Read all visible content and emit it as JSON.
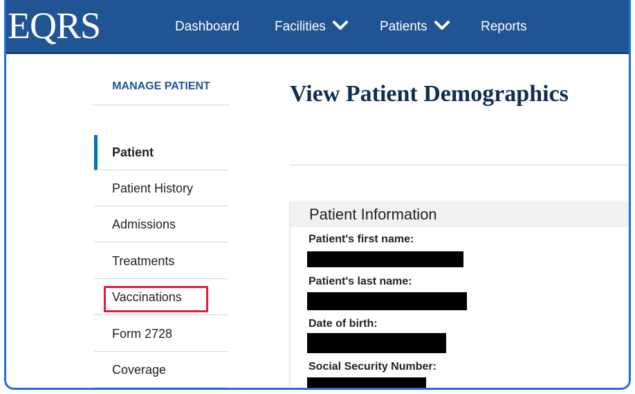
{
  "header": {
    "logo": "EQRS",
    "nav": [
      {
        "label": "Dashboard"
      },
      {
        "label": "Facilities"
      },
      {
        "label": "Patients"
      },
      {
        "label": "Reports"
      }
    ]
  },
  "sidebar": {
    "title": "MANAGE PATIENT",
    "items": [
      {
        "label": "Patient",
        "active": true
      },
      {
        "label": "Patient History"
      },
      {
        "label": "Admissions"
      },
      {
        "label": "Treatments"
      },
      {
        "label": "Vaccinations",
        "highlighted": true
      },
      {
        "label": "Form 2728"
      },
      {
        "label": "Coverage"
      }
    ]
  },
  "main": {
    "page_title": "View Patient Demographics",
    "card": {
      "title": "Patient Information",
      "fields": [
        {
          "label": "Patient's first name:",
          "value_redacted": true
        },
        {
          "label": "Patient's last name:",
          "value_redacted": true
        },
        {
          "label": "Date of birth:",
          "value_redacted": true
        },
        {
          "label": "Social Security Number:",
          "value_redacted": true
        }
      ]
    }
  },
  "colors": {
    "nav_background": "#205493",
    "sidebar_title": "#205493",
    "active_indicator": "#0071bc",
    "highlight_box": "#e31c3d",
    "page_title": "#112e51",
    "redaction": "#000000"
  }
}
